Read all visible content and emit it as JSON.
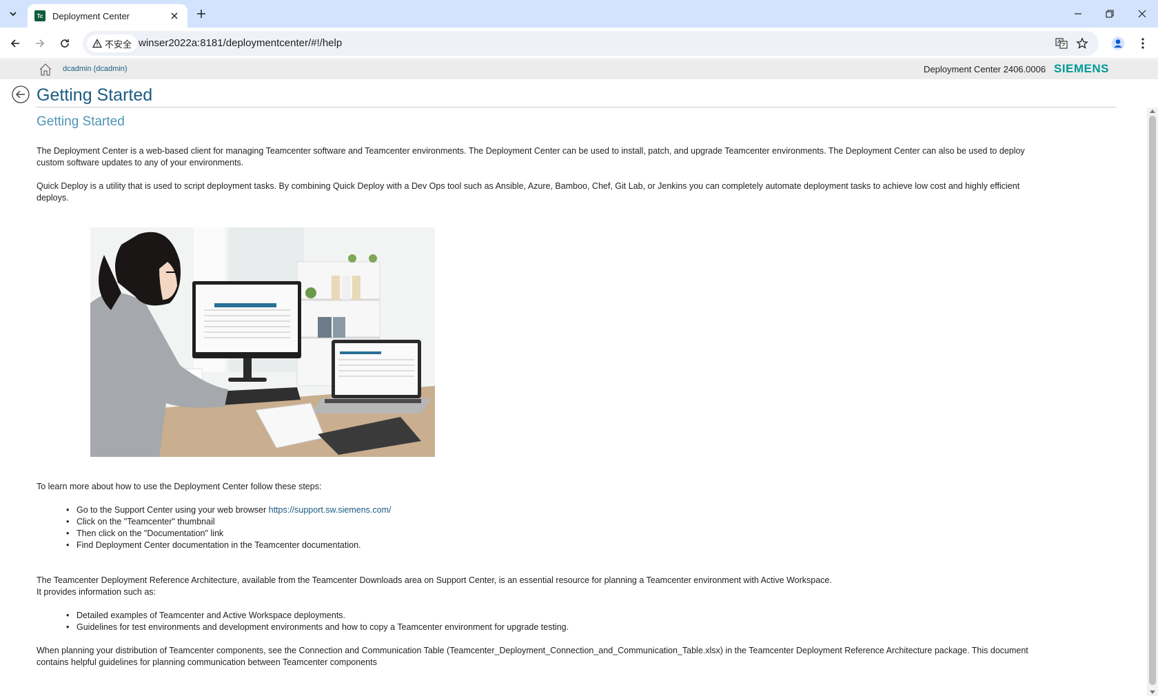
{
  "browser": {
    "tab_title": "Deployment Center",
    "favicon_text": "Tc",
    "security_label": "不安全",
    "url": "winser2022a:8181/deploymentcenter/#!/help"
  },
  "app_header": {
    "user": "dcadmin (dcadmin)",
    "version": "Deployment Center 2406.0006",
    "brand": "SIEMENS",
    "brand_color": "#009999"
  },
  "page": {
    "title": "Getting Started",
    "section_title": "Getting Started",
    "intro_1": "The Deployment Center is a web-based client for managing Teamcenter software and Teamcenter environments. The Deployment Center can be used to install, patch, and upgrade Teamcenter environments. The Deployment Center can also be used to deploy custom software updates to any of your environments.",
    "intro_2": "Quick Deploy is a utility that is used to script deployment tasks. By combining Quick Deploy with a Dev Ops tool such as Ansible, Azure, Bamboo, Chef, Git Lab, or Jenkins you can completely automate deployment tasks to achieve low cost and highly efficient deploys.",
    "learn_more": "To learn more about how to use the Deployment Center follow these steps:",
    "steps": {
      "step1_text": "Go to the Support Center using your web browser ",
      "step1_link": "https://support.sw.siemens.com/",
      "step2": "Click on the \"Teamcenter\" thumbnail",
      "step3": "Then click on the \"Documentation\" link",
      "step4": "Find Deployment Center documentation in the Teamcenter documentation."
    },
    "reference_1": "The Teamcenter Deployment Reference Architecture, available from the Teamcenter Downloads area on Support Center, is an essential resource for planning a Teamcenter environment with Active Workspace.",
    "reference_2": "It provides information such as:",
    "info": {
      "item1": "Detailed examples of Teamcenter and Active Workspace deployments.",
      "item2": "Guidelines for test environments and development environments and how to copy a Teamcenter environment for upgrade testing."
    },
    "closing": "When planning your distribution of Teamcenter components, see the Connection and Communication Table (Teamcenter_Deployment_Connection_and_Communication_Table.xlsx) in the Teamcenter Deployment Reference Architecture package. This document contains helpful guidelines for planning communication between Teamcenter components"
  }
}
